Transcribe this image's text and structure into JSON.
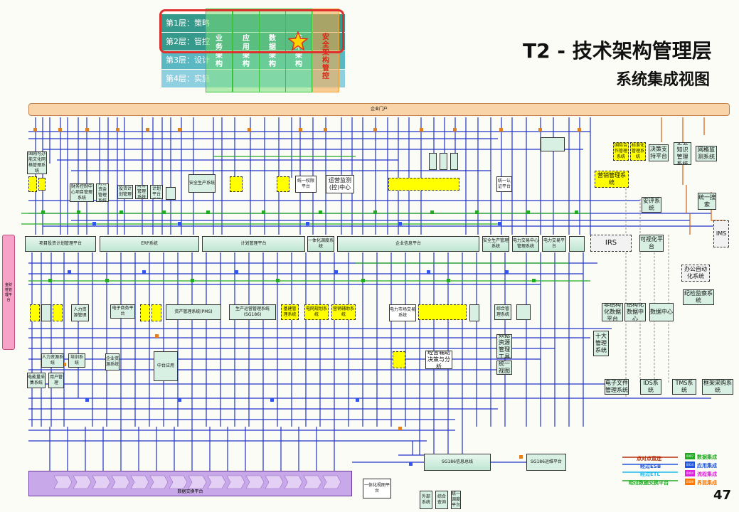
{
  "layers": [
    {
      "label": "第1层：策略"
    },
    {
      "label": "第2层：管控"
    },
    {
      "label": "第3层：设计"
    },
    {
      "label": "第4层：实施"
    }
  ],
  "columns": [
    {
      "chars": [
        "业",
        "务",
        "架",
        "构"
      ]
    },
    {
      "chars": [
        "应",
        "用",
        "架",
        "构"
      ]
    },
    {
      "chars": [
        "数",
        "据",
        "架",
        "构"
      ]
    },
    {
      "chars": [
        "技",
        "术",
        "架",
        "构"
      ]
    },
    {
      "chars": [
        "安",
        "全",
        "架",
        "构",
        "管",
        "控"
      ]
    }
  ],
  "title": "T2 - 技术架构管理层",
  "subtitle": "系统集成视图",
  "top_bar": "企业门户",
  "left_bar": "金财桩管理平台",
  "bottom_bar": "数据交换平台",
  "page_number": "47",
  "colors": {
    "green_col": "#39c439",
    "orange_col": "#f2a03a",
    "highlight": "#e0302e",
    "legend_green": "#22aa22",
    "legend_blue": "#2255dd",
    "legend_magenta": "#dd22dd",
    "legend_orange": "#ff7700"
  },
  "systems": {
    "s1": "国网可办能文化网格管理系统",
    "s2": "财务控制中心项目管理系统",
    "s3": "财务资金管理系统",
    "s4": "投资计划管理",
    "s5": "财务管理系统",
    "s6": "财务计划平台系统",
    "s7": "安全生产系统",
    "s8": "统一权限平台",
    "s9": "运营监测(控)中心",
    "s10": "统一认证平台",
    "s11": "国际合作管理系统",
    "s12": "标准化管理系统",
    "s13": "决策支持平台",
    "s14": "企业知识管理系统",
    "s15": "网格监测系统",
    "s16": "营销管理系统",
    "s17": "ERP系统",
    "s18": "项目投资计划管理平台",
    "s19": "一体化调度系统",
    "s20": "企业信息平台",
    "s21": "安全生产管理系统",
    "s22": "计划管理平台",
    "s23": "电力交易平台",
    "s24": "IRS",
    "s25": "IMS",
    "s26": "安评系统",
    "s27": "统一搜索",
    "s28": "可视化平台",
    "s29": "办公自动化系统",
    "s30": "电子商务平台",
    "s31": "资产管理系统(PMS)",
    "s32": "生产运营管理系统(SG186)",
    "s33": "基建管理系统",
    "s34": "电网规划系统",
    "s35": "营销辅助系统",
    "s36": "电力市场交易系统",
    "s37": "经营辅助决策与分析",
    "s38": "数据资源管理工具",
    "s39": "统一视图",
    "s40": "综合管理系统",
    "s41": "非结构化数据平台",
    "s42": "结构化数据中心",
    "s43": "数据中心",
    "s44": "纪检监察系统",
    "s45": "十大管理系统",
    "s46": "电子文件管理系统",
    "s47": "IDS系统",
    "s48": "TMS系统",
    "s49": "框架采购系统",
    "s50": "SG186信息总线",
    "s51": "SG186运维平台",
    "s52": "一体化视图平台",
    "s53": "外部系统",
    "s54": "综合查询",
    "s55": "电力交易中心管理系统",
    "s56": "人力资源管理",
    "s57": "人力资源系统",
    "s58": "中台应用",
    "s59": "电能量采集系统",
    "s60": "培训系统",
    "s61": "企业资源系统",
    "s62": "用户管理",
    "s63": "统一调度平台"
  },
  "legend": {
    "lines": [
      "点对点直连",
      "经过ESB",
      "经过ETL",
      "经过数据交换平台"
    ],
    "badges": [
      {
        "tag": "0007",
        "text": "数据集成"
      },
      {
        "tag": "0014",
        "text": "应用集成"
      },
      {
        "tag": "0004",
        "text": "流程集成"
      },
      {
        "tag": "0008",
        "text": "界面集成"
      }
    ]
  }
}
